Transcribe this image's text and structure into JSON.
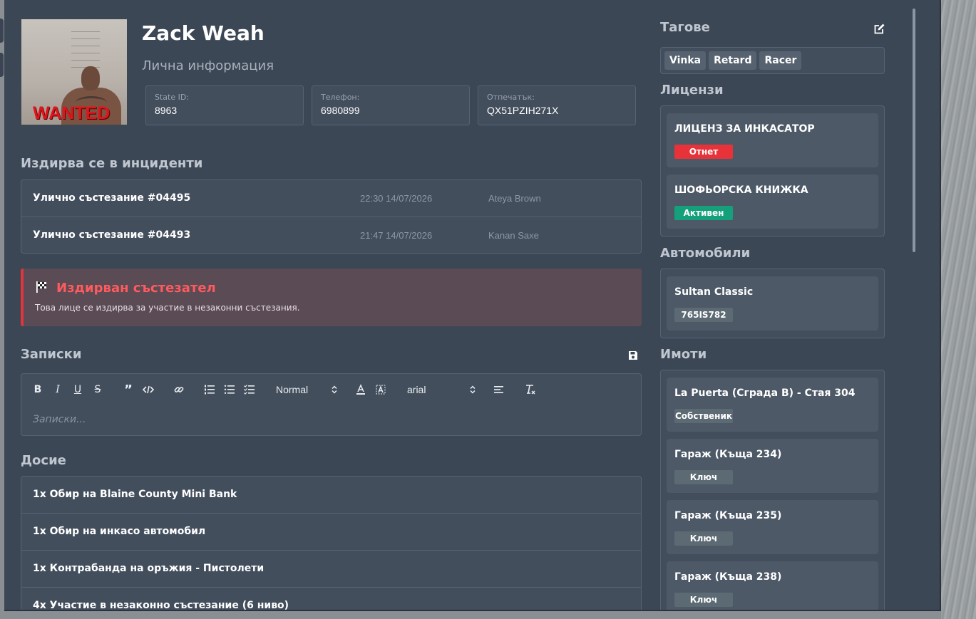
{
  "profile": {
    "name": "Zack Weah",
    "subtitle": "Лична информация",
    "wanted_stamp": "WANTED",
    "fields": [
      {
        "label": "State ID:",
        "value": "8963"
      },
      {
        "label": "Телефон:",
        "value": "6980899"
      },
      {
        "label": "Отпечатък:",
        "value": "QX51PZIH271X"
      }
    ]
  },
  "incidents": {
    "title": "Издирва се в инциденти",
    "rows": [
      {
        "title": "Улично състезание #04495",
        "datetime": "22:30 14/07/2026",
        "officer": "Ateya Brown"
      },
      {
        "title": "Улично състезание #04493",
        "datetime": "21:47 14/07/2026",
        "officer": "Kanan Saxe"
      }
    ]
  },
  "alert": {
    "icon": "checkered-flag-icon",
    "title": "Издирван състезател",
    "text": "Това лице се издирва за участие в незаконни състезания.",
    "accent_color": "#e0353d"
  },
  "notes": {
    "title": "Записки",
    "placeholder": "Записки...",
    "header_select": "Normal",
    "font_select": "arial"
  },
  "dossier": {
    "title": "Досие",
    "rows": [
      "1x Обир на Blaine County Mini Bank",
      "1x Обир на инкасо автомобил",
      "1x Контрабанда на оръжия - Пистолети",
      "4x Участие в незаконно състезание (6 ниво)"
    ]
  },
  "tags": {
    "title": "Тагове",
    "items": [
      "Vinka",
      "Retard",
      "Racer"
    ]
  },
  "licenses": {
    "title": "Лицензи",
    "items": [
      {
        "name": "ЛИЦЕНЗ ЗА ИНКАСАТОР",
        "status": "Отнет",
        "color": "#e8323a"
      },
      {
        "name": "ШОФЬОРСКА КНИЖКА",
        "status": "Активен",
        "color": "#13a07a"
      }
    ]
  },
  "vehicles": {
    "title": "Автомобили",
    "items": [
      {
        "name": "Sultan Classic",
        "plate": "765IS782"
      }
    ]
  },
  "properties": {
    "title": "Имоти",
    "items": [
      {
        "name": "La Puerta (Сграда B) - Стая 304",
        "role": "Собственик"
      },
      {
        "name": "Гараж (Къща 234)",
        "role": "Ключ"
      },
      {
        "name": "Гараж (Къща 235)",
        "role": "Ключ"
      },
      {
        "name": "Гараж (Къща 238)",
        "role": "Ключ"
      }
    ]
  }
}
